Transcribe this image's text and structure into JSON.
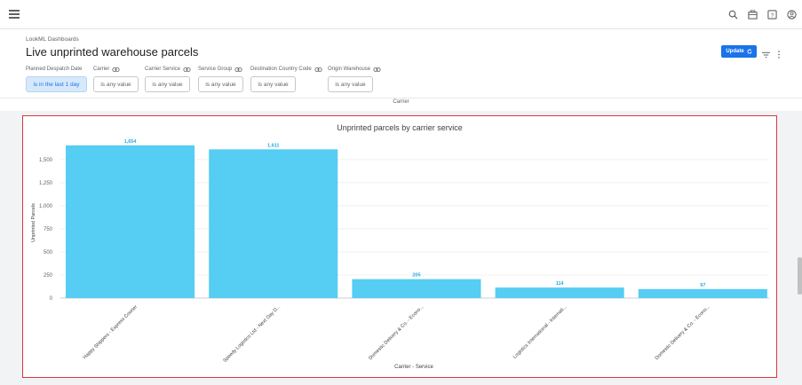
{
  "topbar": {
    "icons": [
      "menu-icon",
      "search-icon",
      "bag-icon",
      "help-icon",
      "account-icon"
    ]
  },
  "header": {
    "breadcrumb": "LookML Dashboards",
    "title": "Live unprinted warehouse parcels",
    "update_label": "Update"
  },
  "filters": [
    {
      "label": "Planned Despatch Date",
      "value": "is in the last 1 day",
      "active": true,
      "linked": false
    },
    {
      "label": "Carrier",
      "value": "is any value",
      "active": false,
      "linked": true
    },
    {
      "label": "Carrier Service",
      "value": "is any value",
      "active": false,
      "linked": true
    },
    {
      "label": "Service Group",
      "value": "is any value",
      "active": false,
      "linked": true
    },
    {
      "label": "Destination Country Code",
      "value": "is any value",
      "active": false,
      "linked": true
    },
    {
      "label": "Origin Warehouse",
      "value": "is any value",
      "active": false,
      "linked": true
    }
  ],
  "strip": {
    "label": "Carrier"
  },
  "colors": {
    "accent": "#1a73e8",
    "bar": "#56cdf2",
    "bar_label": "#29a8e0",
    "highlight_border": "#d9363e"
  },
  "chart_data": {
    "type": "bar",
    "title": "Unprinted parcels by carrier service",
    "xlabel": "Carrier - Service",
    "ylabel": "Unprinted Parcels",
    "categories": [
      "Happy Shippers - Express Courier",
      "Speedy Logistics Ltd - Next Day D...",
      "Domestic Delivery & Co. - Econo...",
      "Logistics International - Internati...",
      "Domestic Delivery & Co. - Econo..."
    ],
    "values": [
      1654,
      1611,
      205,
      114,
      97
    ],
    "value_labels": [
      "1,654",
      "1,611",
      "205",
      "114",
      "97"
    ],
    "yticks": [
      0,
      250,
      500,
      750,
      1000,
      1250,
      1500
    ],
    "ytick_labels": [
      "0",
      "250",
      "500",
      "750",
      "1,000",
      "1,250",
      "1,500"
    ],
    "ylim": [
      0,
      1720
    ],
    "grid": true,
    "legend": "none"
  }
}
